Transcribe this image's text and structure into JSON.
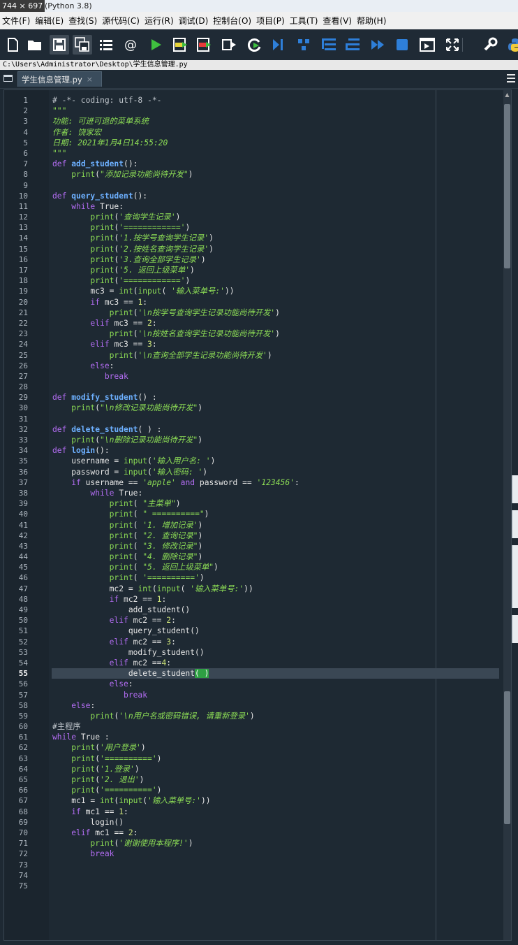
{
  "window": {
    "size_badge": "744 × 697",
    "title": "(Python 3.8)"
  },
  "menu": [
    "文件(F)",
    "编辑(E)",
    "查找(S)",
    "源代码(C)",
    "运行(R)",
    "调试(D)",
    "控制台(O)",
    "项目(P)",
    "工具(T)",
    "查看(V)",
    "帮助(H)"
  ],
  "toolbar": {
    "icons": [
      "new-file-icon",
      "open-folder-icon",
      "save-icon",
      "save-all-icon",
      "outline-list-icon",
      "at-sign-icon",
      "run-icon",
      "run-cell-icon",
      "run-cell-advance-icon",
      "run-selection-icon",
      "rerun-icon",
      "debug-icon",
      "step-icon",
      "step-into-icon",
      "step-return-icon",
      "continue-icon",
      "stop-icon",
      "maximize-pane-icon",
      "fullscreen-icon",
      "preferences-icon",
      "python-path-icon"
    ],
    "colors": {
      "run": "#3fbf3f",
      "debug": "#2e7fd9",
      "bg": "#1f2a35"
    }
  },
  "path": "C:\\Users\\Administrator\\Desktop\\学生信息管理.py",
  "tab": {
    "label": "学生信息管理.py",
    "close": "×"
  },
  "editor": {
    "current_line": 55,
    "lines": [
      [
        [
          "cm",
          "# -*- coding: utf-8 -*-"
        ]
      ],
      [
        [
          "cm-it",
          "\"\"\""
        ]
      ],
      [
        [
          "cm-it",
          "功能: 可进可退的菜单系统"
        ]
      ],
      [
        [
          "cm-it",
          "作者: 饶家宏"
        ]
      ],
      [
        [
          "cm-it",
          "日期: 2021年1月4日14:55:20"
        ]
      ],
      [
        [
          "cm-it",
          "\"\"\""
        ]
      ],
      [
        [
          "kw",
          "def "
        ],
        [
          "fn",
          "add_student"
        ],
        [
          "plain",
          "():"
        ]
      ],
      [
        [
          "plain",
          "    "
        ],
        [
          "bi",
          "print"
        ],
        [
          "plain",
          "("
        ],
        [
          "st",
          "\"添加记录功能尚待开发\""
        ],
        [
          "plain",
          ")"
        ]
      ],
      [],
      [
        [
          "kw",
          "def "
        ],
        [
          "fn",
          "query_student"
        ],
        [
          "plain",
          "():"
        ]
      ],
      [
        [
          "plain",
          "    "
        ],
        [
          "kw",
          "while "
        ],
        [
          "plain",
          "True:"
        ]
      ],
      [
        [
          "plain",
          "        "
        ],
        [
          "bi",
          "print"
        ],
        [
          "plain",
          "("
        ],
        [
          "st",
          "'查询学生记录'"
        ],
        [
          "plain",
          ")"
        ]
      ],
      [
        [
          "plain",
          "        "
        ],
        [
          "bi",
          "print"
        ],
        [
          "plain",
          "("
        ],
        [
          "st",
          "'============'"
        ],
        [
          "plain",
          ")"
        ]
      ],
      [
        [
          "plain",
          "        "
        ],
        [
          "bi",
          "print"
        ],
        [
          "plain",
          "("
        ],
        [
          "st",
          "'1.按学号查询学生记录'"
        ],
        [
          "plain",
          ")"
        ]
      ],
      [
        [
          "plain",
          "        "
        ],
        [
          "bi",
          "print"
        ],
        [
          "plain",
          "("
        ],
        [
          "st",
          "'2.按姓名查询学生记录'"
        ],
        [
          "plain",
          ")"
        ]
      ],
      [
        [
          "plain",
          "        "
        ],
        [
          "bi",
          "print"
        ],
        [
          "plain",
          "("
        ],
        [
          "st",
          "'3.查询全部学生记录'"
        ],
        [
          "plain",
          ")"
        ]
      ],
      [
        [
          "plain",
          "        "
        ],
        [
          "bi",
          "print"
        ],
        [
          "plain",
          "("
        ],
        [
          "st",
          "'5. 返回上级菜单'"
        ],
        [
          "plain",
          ")"
        ]
      ],
      [
        [
          "plain",
          "        "
        ],
        [
          "bi",
          "print"
        ],
        [
          "plain",
          "("
        ],
        [
          "st",
          "'============'"
        ],
        [
          "plain",
          ")"
        ]
      ],
      [
        [
          "plain",
          "        mc3 = "
        ],
        [
          "bi",
          "int"
        ],
        [
          "plain",
          "("
        ],
        [
          "bi",
          "input"
        ],
        [
          "plain",
          "( "
        ],
        [
          "st",
          "'输入菜单号:'"
        ],
        [
          "plain",
          "))"
        ]
      ],
      [
        [
          "plain",
          "        "
        ],
        [
          "kw",
          "if "
        ],
        [
          "plain",
          "mc3 == "
        ],
        [
          "nm",
          "1"
        ],
        [
          "plain",
          ":"
        ]
      ],
      [
        [
          "plain",
          "            "
        ],
        [
          "bi",
          "print"
        ],
        [
          "plain",
          "("
        ],
        [
          "st",
          "'\\n按学号查询学生记录功能尚待开发'"
        ],
        [
          "plain",
          ")"
        ]
      ],
      [
        [
          "plain",
          "        "
        ],
        [
          "kw",
          "elif "
        ],
        [
          "plain",
          "mc3 == "
        ],
        [
          "nm",
          "2"
        ],
        [
          "plain",
          ":"
        ]
      ],
      [
        [
          "plain",
          "            "
        ],
        [
          "bi",
          "print"
        ],
        [
          "plain",
          "("
        ],
        [
          "st",
          "'\\n按姓名查询学生记录功能尚待开发'"
        ],
        [
          "plain",
          ")"
        ]
      ],
      [
        [
          "plain",
          "        "
        ],
        [
          "kw",
          "elif "
        ],
        [
          "plain",
          "mc3 == "
        ],
        [
          "nm",
          "3"
        ],
        [
          "plain",
          ":"
        ]
      ],
      [
        [
          "plain",
          "            "
        ],
        [
          "bi",
          "print"
        ],
        [
          "plain",
          "("
        ],
        [
          "st",
          "'\\n查询全部学生记录功能尚待开发'"
        ],
        [
          "plain",
          ")"
        ]
      ],
      [
        [
          "plain",
          "        "
        ],
        [
          "kw",
          "else"
        ],
        [
          "plain",
          ":"
        ]
      ],
      [
        [
          "plain",
          "           "
        ],
        [
          "kw",
          "break"
        ]
      ],
      [],
      [
        [
          "kw",
          "def "
        ],
        [
          "fn",
          "modify_student"
        ],
        [
          "plain",
          "() :"
        ]
      ],
      [
        [
          "plain",
          "    "
        ],
        [
          "bi",
          "print"
        ],
        [
          "plain",
          "("
        ],
        [
          "st",
          "\"\\n修改记录功能尚待开发\""
        ],
        [
          "plain",
          ")"
        ]
      ],
      [],
      [
        [
          "kw",
          "def "
        ],
        [
          "fn",
          "delete_student"
        ],
        [
          "plain",
          "( ) :"
        ]
      ],
      [
        [
          "plain",
          "    "
        ],
        [
          "bi",
          "print"
        ],
        [
          "plain",
          "("
        ],
        [
          "st",
          "\"\\n删除记录功能尚待开发\""
        ],
        [
          "plain",
          ")"
        ]
      ],
      [
        [
          "kw",
          "def "
        ],
        [
          "fn",
          "login"
        ],
        [
          "plain",
          "():"
        ]
      ],
      [
        [
          "plain",
          "    username = "
        ],
        [
          "bi",
          "input"
        ],
        [
          "plain",
          "("
        ],
        [
          "st",
          "'输入用户名: '"
        ],
        [
          "plain",
          ")"
        ]
      ],
      [
        [
          "plain",
          "    password = "
        ],
        [
          "bi",
          "input"
        ],
        [
          "plain",
          "("
        ],
        [
          "st",
          "'输入密码: '"
        ],
        [
          "plain",
          ")"
        ]
      ],
      [
        [
          "plain",
          "    "
        ],
        [
          "kw",
          "if "
        ],
        [
          "plain",
          "username == "
        ],
        [
          "st",
          "'apple'"
        ],
        [
          "plain",
          " "
        ],
        [
          "kw",
          "and "
        ],
        [
          "plain",
          "password == "
        ],
        [
          "st",
          "'123456'"
        ],
        [
          "plain",
          ":"
        ]
      ],
      [
        [
          "plain",
          "        "
        ],
        [
          "kw",
          "while "
        ],
        [
          "plain",
          "True:"
        ]
      ],
      [
        [
          "plain",
          "            "
        ],
        [
          "bi",
          "print"
        ],
        [
          "plain",
          "( "
        ],
        [
          "st",
          "\"主菜单\""
        ],
        [
          "plain",
          ")"
        ]
      ],
      [
        [
          "plain",
          "            "
        ],
        [
          "bi",
          "print"
        ],
        [
          "plain",
          "( "
        ],
        [
          "st",
          "\" ==========\""
        ],
        [
          "plain",
          ")"
        ]
      ],
      [
        [
          "plain",
          "            "
        ],
        [
          "bi",
          "print"
        ],
        [
          "plain",
          "( "
        ],
        [
          "st",
          "'1. 增加记录'"
        ],
        [
          "plain",
          ")"
        ]
      ],
      [
        [
          "plain",
          "            "
        ],
        [
          "bi",
          "print"
        ],
        [
          "plain",
          "( "
        ],
        [
          "st",
          "\"2. 查询记录\""
        ],
        [
          "plain",
          ")"
        ]
      ],
      [
        [
          "plain",
          "            "
        ],
        [
          "bi",
          "print"
        ],
        [
          "plain",
          "( "
        ],
        [
          "st",
          "\"3. 修改记录\""
        ],
        [
          "plain",
          ")"
        ]
      ],
      [
        [
          "plain",
          "            "
        ],
        [
          "bi",
          "print"
        ],
        [
          "plain",
          "( "
        ],
        [
          "st",
          "\"4. 删除记录\""
        ],
        [
          "plain",
          ")"
        ]
      ],
      [
        [
          "plain",
          "            "
        ],
        [
          "bi",
          "print"
        ],
        [
          "plain",
          "( "
        ],
        [
          "st",
          "\"5. 返回上级菜单\""
        ],
        [
          "plain",
          ")"
        ]
      ],
      [
        [
          "plain",
          "            "
        ],
        [
          "bi",
          "print"
        ],
        [
          "plain",
          "( "
        ],
        [
          "st",
          "'=========='"
        ],
        [
          "plain",
          ")"
        ]
      ],
      [
        [
          "plain",
          "            mc2 = "
        ],
        [
          "bi",
          "int"
        ],
        [
          "plain",
          "("
        ],
        [
          "bi",
          "input"
        ],
        [
          "plain",
          "( "
        ],
        [
          "st",
          "'输入菜单号:'"
        ],
        [
          "plain",
          "))"
        ]
      ],
      [
        [
          "plain",
          "            "
        ],
        [
          "kw",
          "if "
        ],
        [
          "plain",
          "mc2 == "
        ],
        [
          "nm",
          "1"
        ],
        [
          "plain",
          ":"
        ]
      ],
      [
        [
          "plain",
          "                add_student()"
        ]
      ],
      [
        [
          "plain",
          "            "
        ],
        [
          "kw",
          "elif "
        ],
        [
          "plain",
          "mc2 == "
        ],
        [
          "nm",
          "2"
        ],
        [
          "plain",
          ":"
        ]
      ],
      [
        [
          "plain",
          "                query_student()"
        ]
      ],
      [
        [
          "plain",
          "            "
        ],
        [
          "kw",
          "elif "
        ],
        [
          "plain",
          "mc2 == "
        ],
        [
          "nm",
          "3"
        ],
        [
          "plain",
          ":"
        ]
      ],
      [
        [
          "plain",
          "                modify_student()"
        ]
      ],
      [
        [
          "plain",
          "            "
        ],
        [
          "kw",
          "elif "
        ],
        [
          "plain",
          "mc2 =="
        ],
        [
          "nm",
          "4"
        ],
        [
          "plain",
          ":"
        ]
      ],
      [
        [
          "plain",
          "                delete_student"
        ],
        [
          "br",
          "( )"
        ]
      ],
      [
        [
          "plain",
          "            "
        ],
        [
          "kw",
          "else"
        ],
        [
          "plain",
          ":"
        ]
      ],
      [
        [
          "plain",
          "               "
        ],
        [
          "kw",
          "break"
        ]
      ],
      [
        [
          "plain",
          "    "
        ],
        [
          "kw",
          "else"
        ],
        [
          "plain",
          ":"
        ]
      ],
      [
        [
          "plain",
          "        "
        ],
        [
          "bi",
          "print"
        ],
        [
          "plain",
          "("
        ],
        [
          "st",
          "'\\n用户名或密码错误, 请重新登录'"
        ],
        [
          "plain",
          ")"
        ]
      ],
      [
        [
          "cm",
          "#主程序"
        ]
      ],
      [
        [
          "kw",
          "while "
        ],
        [
          "plain",
          "True :"
        ]
      ],
      [
        [
          "plain",
          "    "
        ],
        [
          "bi",
          "print"
        ],
        [
          "plain",
          "("
        ],
        [
          "st",
          "'用户登录'"
        ],
        [
          "plain",
          ")"
        ]
      ],
      [
        [
          "plain",
          "    "
        ],
        [
          "bi",
          "print"
        ],
        [
          "plain",
          "("
        ],
        [
          "st",
          "'=========='"
        ],
        [
          "plain",
          ")"
        ]
      ],
      [
        [
          "plain",
          "    "
        ],
        [
          "bi",
          "print"
        ],
        [
          "plain",
          "("
        ],
        [
          "st",
          "'1.登录'"
        ],
        [
          "plain",
          ")"
        ]
      ],
      [
        [
          "plain",
          "    "
        ],
        [
          "bi",
          "print"
        ],
        [
          "plain",
          "("
        ],
        [
          "st",
          "'2. 退出'"
        ],
        [
          "plain",
          ")"
        ]
      ],
      [
        [
          "plain",
          "    "
        ],
        [
          "bi",
          "print"
        ],
        [
          "plain",
          "("
        ],
        [
          "st",
          "'=========='"
        ],
        [
          "plain",
          ")"
        ]
      ],
      [
        [
          "plain",
          "    mc1 = "
        ],
        [
          "bi",
          "int"
        ],
        [
          "plain",
          "("
        ],
        [
          "bi",
          "input"
        ],
        [
          "plain",
          "("
        ],
        [
          "st",
          "'输入菜单号:'"
        ],
        [
          "plain",
          "))"
        ]
      ],
      [
        [
          "plain",
          "    "
        ],
        [
          "kw",
          "if "
        ],
        [
          "plain",
          "mc1 == "
        ],
        [
          "nm",
          "1"
        ],
        [
          "plain",
          ":"
        ]
      ],
      [
        [
          "plain",
          "        login()"
        ]
      ],
      [
        [
          "plain",
          "    "
        ],
        [
          "kw",
          "elif "
        ],
        [
          "plain",
          "mc1 == "
        ],
        [
          "nm",
          "2"
        ],
        [
          "plain",
          ":"
        ]
      ],
      [
        [
          "plain",
          "        "
        ],
        [
          "bi",
          "print"
        ],
        [
          "plain",
          "("
        ],
        [
          "st",
          "'谢谢使用本程序!'"
        ],
        [
          "plain",
          ")"
        ]
      ],
      [
        [
          "plain",
          "        "
        ],
        [
          "kw",
          "break"
        ]
      ],
      [],
      [],
      []
    ]
  }
}
